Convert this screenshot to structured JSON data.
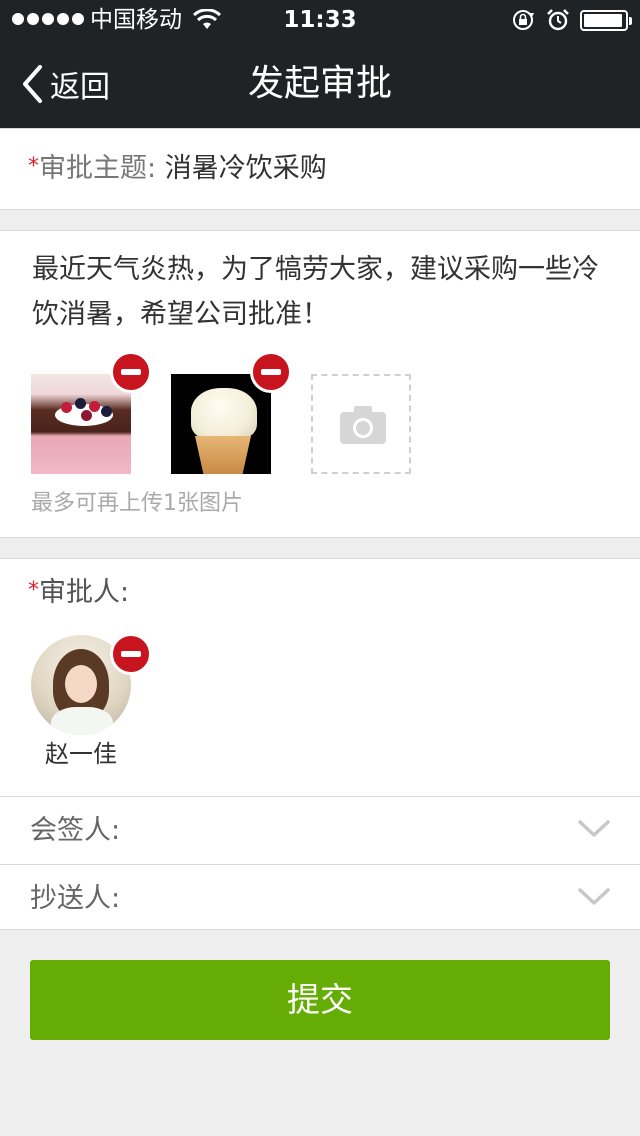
{
  "status_bar": {
    "carrier": "中国移动",
    "time": "11:33"
  },
  "navbar": {
    "back_label": "返回",
    "title": "发起审批"
  },
  "form": {
    "required_mark": "*",
    "subject_label": "审批主题:",
    "subject_value": "消暑冷饮采购",
    "description": "最近天气炎热，为了犒劳大家，建议采购一些冷饮消暑，希望公司批准！",
    "upload_hint": "最多可再上传1张图片",
    "approver_label": "审批人:",
    "approver_name": "赵一佳",
    "cosigner_label": "会签人:",
    "cc_label": "抄送人:",
    "submit_label": "提交"
  },
  "colors": {
    "header_bg": "#1f2326",
    "submit_green": "#65ad04",
    "remove_red": "#c8141f",
    "required_red": "#d9232f",
    "page_bg": "#efeff0"
  },
  "icons": [
    "wifi-icon",
    "lock-rotation-icon",
    "alarm-icon",
    "battery-icon",
    "back-chevron-icon",
    "camera-icon",
    "remove-icon",
    "chevron-down-icon"
  ]
}
